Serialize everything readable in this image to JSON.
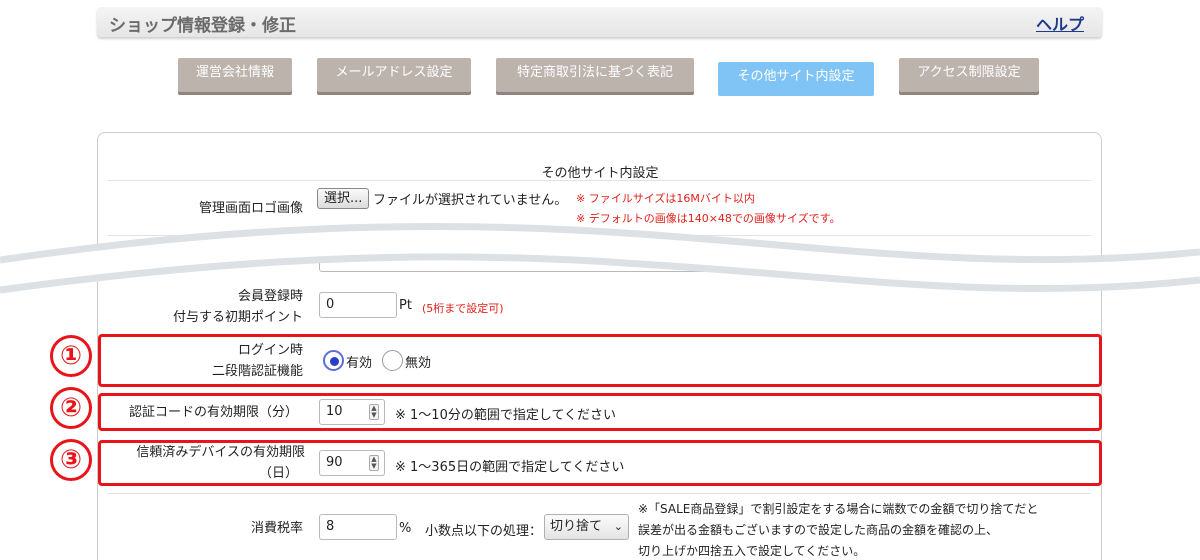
{
  "header": {
    "title": "ショップ情報登録・修正",
    "help": "ヘルプ"
  },
  "tabs": [
    {
      "label": "運営会社情報"
    },
    {
      "label": "メールアドレス設定"
    },
    {
      "label": "特定商取引法に基づく表記"
    },
    {
      "label": "その他サイト内設定"
    },
    {
      "label": "アクセス制限設定"
    }
  ],
  "section_title": "その他サイト内設定",
  "logo": {
    "label": "管理画面ロゴ画像",
    "button": "選択...",
    "status": "ファイルが選択されていません。",
    "note1": "※ ファイルサイズは16Mバイト以内",
    "note2": "※ デフォルトの画像は140×48での画像サイズです。"
  },
  "points": {
    "label1": "会員登録時",
    "label2": "付与する初期ポイント",
    "value": "0",
    "unit": "Pt",
    "note": "(5桁まで設定可)"
  },
  "twofa": {
    "label1": "ログイン時",
    "label2": "二段階認証機能",
    "enabled": "有効",
    "disabled": "無効"
  },
  "code_expiry": {
    "label": "認証コードの有効期限（分）",
    "value": "10",
    "note": "※ 1～10分の範囲で指定してください"
  },
  "device_expiry": {
    "label1": "信頼済みデバイスの有効期限",
    "label2": "（日）",
    "value": "90",
    "note": "※ 1～365日の範囲で指定してください"
  },
  "tax": {
    "label": "消費税率",
    "value": "8",
    "unit": "%",
    "rounding_label": "小数点以下の処理：",
    "rounding_value": "切り捨て",
    "note1": "※「SALE商品登録」で割引設定をする場合に端数での金額で切り捨てだと",
    "note2": "誤差が出る金額もございますので設定した商品の金額を確認の上、",
    "note3": "切り上げか四捨五入で設定してください。"
  },
  "badges": [
    "①",
    "②",
    "③"
  ],
  "colors": {
    "highlight": "#e8141a",
    "tab": "#bcb3ad",
    "tab_active": "#7fc4f5",
    "note": "#e0201b"
  }
}
